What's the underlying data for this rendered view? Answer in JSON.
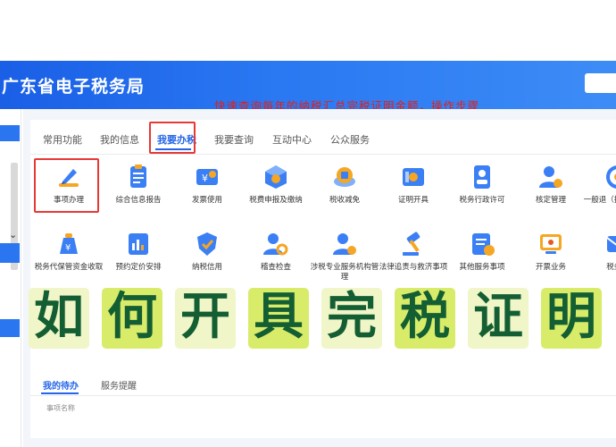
{
  "header": {
    "title": "广东省电子税务局"
  },
  "overlay_caption": "快速查询每年的纳税汇总完税证明金额，操作步骤",
  "tabs": [
    {
      "label": "常用功能"
    },
    {
      "label": "我的信息"
    },
    {
      "label": "我要办税"
    },
    {
      "label": "我要查询"
    },
    {
      "label": "互动中心"
    },
    {
      "label": "公众服务"
    }
  ],
  "active_tab": "我要办税",
  "grid_row1": [
    {
      "label": "事项办理",
      "icon": "pen-icon"
    },
    {
      "label": "综合信息报告",
      "icon": "clipboard-icon"
    },
    {
      "label": "发票使用",
      "icon": "invoice-icon"
    },
    {
      "label": "税费申报及缴纳",
      "icon": "tax-cube-icon"
    },
    {
      "label": "税收减免",
      "icon": "coin-icon"
    },
    {
      "label": "证明开具",
      "icon": "certificate-icon"
    },
    {
      "label": "税务行政许可",
      "icon": "id-card-icon"
    },
    {
      "label": "核定管理",
      "icon": "user-gear-icon"
    },
    {
      "label": "一般退（抵）税管理",
      "icon": "refresh-icon"
    }
  ],
  "grid_row2": [
    {
      "label": "税务代保管资金收取",
      "icon": "money-bag-icon"
    },
    {
      "label": "预约定价安排",
      "icon": "chart-doc-icon"
    },
    {
      "label": "纳税信用",
      "icon": "shield-check-icon"
    },
    {
      "label": "稽查检查",
      "icon": "user-search-icon"
    },
    {
      "label": "涉税专业服务机构管理",
      "icon": "user-gear-icon"
    },
    {
      "label": "法律追责与救济事项",
      "icon": "gavel-icon"
    },
    {
      "label": "其他服务事项",
      "icon": "doc-plus-icon"
    },
    {
      "label": "开票业务",
      "icon": "tv-ticket-icon"
    },
    {
      "label": "税务数",
      "icon": "mail-icon"
    }
  ],
  "banner_chars": [
    "如",
    "何",
    "开",
    "具",
    "完",
    "税",
    "证",
    "明"
  ],
  "bottom_tabs": [
    {
      "label": "我的待办"
    },
    {
      "label": "服务提醒"
    }
  ],
  "cutoff_text": "事项名称",
  "colors": {
    "header_blue": "#2a76f0",
    "accent_blue": "#2566e8",
    "red_box": "#e53935",
    "banner_text": "#135e32",
    "banner_box_light": "#f0f6c8",
    "banner_box_dark": "#d8ec6a"
  }
}
